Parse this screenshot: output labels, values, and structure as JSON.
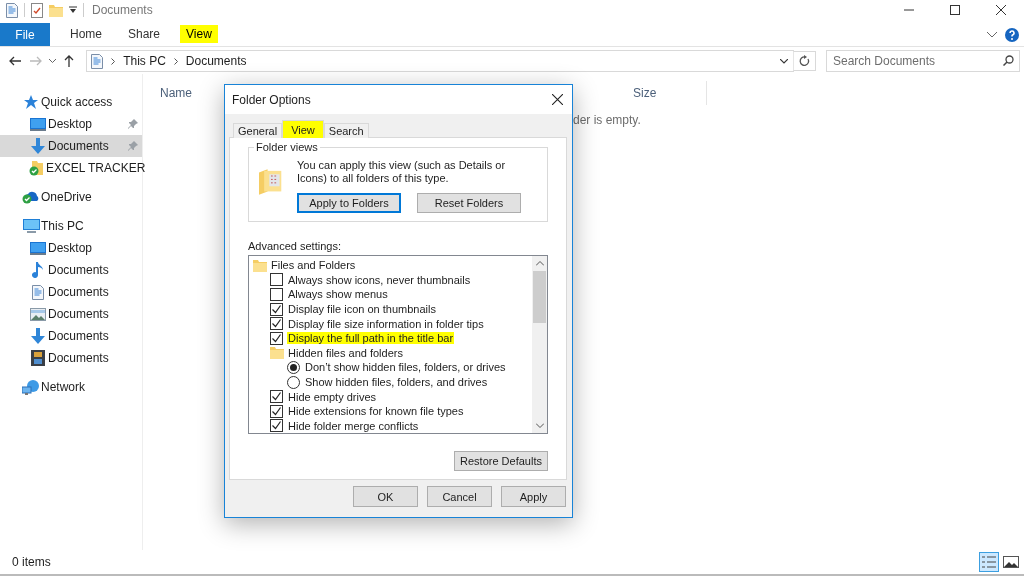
{
  "window": {
    "title": "Documents"
  },
  "ribbon": {
    "tabs": [
      {
        "label": "File",
        "kind": "file",
        "highlighted": false
      },
      {
        "label": "Home",
        "kind": "tab",
        "highlighted": false
      },
      {
        "label": "Share",
        "kind": "tab",
        "highlighted": false
      },
      {
        "label": "View",
        "kind": "tab",
        "highlighted": true
      }
    ]
  },
  "address_bar": {
    "path": [
      "This PC",
      "Documents"
    ]
  },
  "search": {
    "placeholder": "Search Documents"
  },
  "nav_pane": {
    "items": [
      {
        "label": "Quick access",
        "selected": false,
        "children": [
          {
            "label": "Desktop",
            "pinned": true,
            "selected": false
          },
          {
            "label": "Documents",
            "pinned": true,
            "selected": true
          },
          {
            "label": "EXCEL TRACKER",
            "pinned": false,
            "selected": false
          }
        ]
      },
      {
        "label": "OneDrive",
        "selected": false
      },
      {
        "label": "This PC",
        "selected": false,
        "children": [
          {
            "label": "Desktop",
            "pinned": false,
            "selected": false
          },
          {
            "label": "Documents",
            "pinned": false,
            "selected": false
          },
          {
            "label": "Documents",
            "pinned": false,
            "selected": false
          },
          {
            "label": "Documents",
            "pinned": false,
            "selected": false
          },
          {
            "label": "Documents",
            "pinned": false,
            "selected": false
          },
          {
            "label": "Documents",
            "pinned": false,
            "selected": false
          }
        ]
      },
      {
        "label": "Network",
        "selected": false
      }
    ]
  },
  "content": {
    "columns": [
      "Name",
      "Size"
    ],
    "message": "der is empty."
  },
  "status_bar": {
    "item_count": "0 items",
    "views": [
      {
        "selected": true
      },
      {
        "selected": false
      }
    ]
  },
  "dialog": {
    "title": "Folder Options",
    "tabs": [
      {
        "label": "General",
        "selected": false,
        "highlighted": false
      },
      {
        "label": "View",
        "selected": true,
        "highlighted": true
      },
      {
        "label": "Search",
        "selected": false,
        "highlighted": false
      }
    ],
    "folder_views": {
      "heading": "Folder views",
      "text": "You can apply this view (such as Details or Icons) to all folders of this type.",
      "buttons": [
        {
          "label": "Apply to Folders",
          "default": true
        },
        {
          "label": "Reset Folders",
          "default": false
        }
      ]
    },
    "advanced_label": "Advanced settings:",
    "settings": [
      {
        "kind": "group",
        "label": "Files and Folders",
        "highlighted": false,
        "children": [
          {
            "kind": "checkbox",
            "label": "Always show icons, never thumbnails",
            "checked": false,
            "highlighted": false
          },
          {
            "kind": "checkbox",
            "label": "Always show menus",
            "checked": false,
            "highlighted": false
          },
          {
            "kind": "checkbox",
            "label": "Display file icon on thumbnails",
            "checked": true,
            "highlighted": false
          },
          {
            "kind": "checkbox",
            "label": "Display file size information in folder tips",
            "checked": true,
            "highlighted": false
          },
          {
            "kind": "checkbox",
            "label": "Display the full path in the title bar",
            "checked": true,
            "highlighted": true
          },
          {
            "kind": "group",
            "label": "Hidden files and folders",
            "highlighted": false,
            "children": [
              {
                "kind": "radio",
                "label": "Don’t show hidden files, folders, or drives",
                "selected": true,
                "highlighted": false
              },
              {
                "kind": "radio",
                "label": "Show hidden files, folders, and drives",
                "selected": false,
                "highlighted": false
              }
            ]
          },
          {
            "kind": "checkbox",
            "label": "Hide empty drives",
            "checked": true,
            "highlighted": false
          },
          {
            "kind": "checkbox",
            "label": "Hide extensions for known file types",
            "checked": true,
            "highlighted": false
          },
          {
            "kind": "checkbox",
            "label": "Hide folder merge conflicts",
            "checked": true,
            "highlighted": false
          }
        ]
      }
    ],
    "restore_button": "Restore Defaults",
    "buttons": [
      "OK",
      "Cancel",
      "Apply"
    ]
  }
}
